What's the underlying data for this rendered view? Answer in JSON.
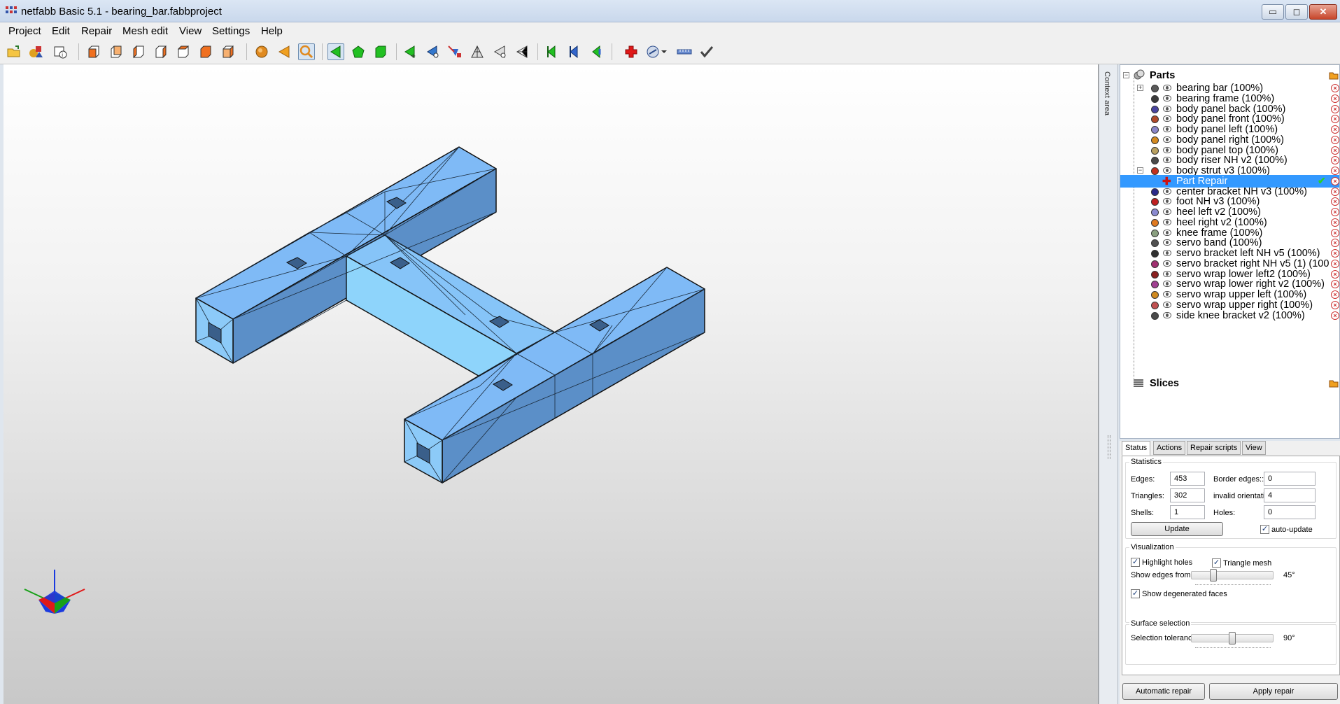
{
  "window": {
    "title": "netfabb Basic 5.1 - bearing_bar.fabbproject",
    "controls": {
      "minimize": "▭",
      "maximize": "◻",
      "close": "✕"
    }
  },
  "menu": [
    "Project",
    "Edit",
    "Repair",
    "Mesh edit",
    "View",
    "Settings",
    "Help"
  ],
  "toolbar": {
    "icons": [
      "open-project-icon",
      "add-part-icon",
      "part-info-icon",
      "view-front-icon",
      "view-back-icon",
      "view-left-icon",
      "view-right-icon",
      "view-top-icon",
      "view-bottom-icon",
      "view-iso-icon",
      "shading-icon",
      "select-triangle-icon",
      "zoom-icon",
      "select-pointer-icon",
      "select-surface-icon",
      "select-shell-icon",
      "add-triangle-icon",
      "cut-icon",
      "move-icon",
      "mesh-icon",
      "mesh-remove-icon",
      "mesh-edit-icon",
      "arrow-green-icon",
      "arrow-blue-icon",
      "arrow-back-icon",
      "add-repair-icon",
      "measure-icon",
      "ruler-icon",
      "apply-check-icon"
    ]
  },
  "context_area": {
    "label": "Context area"
  },
  "tree": {
    "root": "Parts",
    "parts": [
      {
        "label": "bearing bar (100%)",
        "color": "#5a5a5a"
      },
      {
        "label": "bearing frame (100%)",
        "color": "#3a3a3a"
      },
      {
        "label": "body panel back (100%)",
        "color": "#4a45a0"
      },
      {
        "label": "body panel front (100%)",
        "color": "#b04a2a"
      },
      {
        "label": "body panel left (100%)",
        "color": "#8a86c8"
      },
      {
        "label": "body panel right (100%)",
        "color": "#d48a20"
      },
      {
        "label": "body panel top (100%)",
        "color": "#b8a060"
      },
      {
        "label": "body riser NH v2 (100%)",
        "color": "#4a4a4a"
      },
      {
        "label": "body strut v3 (100%)",
        "color": "#c03020"
      },
      {
        "label": "Part Repair",
        "color": "#cc1111"
      },
      {
        "label": "center bracket NH v3 (100%)",
        "color": "#2a2a8a"
      },
      {
        "label": "foot NH v3 (100%)",
        "color": "#c02020"
      },
      {
        "label": "heel left v2 (100%)",
        "color": "#8a8ad0"
      },
      {
        "label": "heel right v2 (100%)",
        "color": "#e07a20"
      },
      {
        "label": "knee frame (100%)",
        "color": "#8aa080"
      },
      {
        "label": "servo band (100%)",
        "color": "#505050"
      },
      {
        "label": "servo bracket left NH v5 (100%)",
        "color": "#303030"
      },
      {
        "label": "servo bracket right NH v5 (1) (100",
        "color": "#a03070"
      },
      {
        "label": "servo wrap lower left2 (100%)",
        "color": "#8a2020"
      },
      {
        "label": "servo wrap lower right v2 (100%)",
        "color": "#a04090"
      },
      {
        "label": "servo wrap upper left (100%)",
        "color": "#d08a20"
      },
      {
        "label": "servo wrap upper right (100%)",
        "color": "#c05050"
      },
      {
        "label": "side knee bracket v2 (100%)",
        "color": "#4a4a4a"
      }
    ],
    "slices": "Slices"
  },
  "tabs": [
    "Status",
    "Actions",
    "Repair scripts",
    "View"
  ],
  "statistics": {
    "title": "Statistics",
    "edges_label": "Edges:",
    "edges": "453",
    "triangles_label": "Triangles:",
    "triangles": "302",
    "shells_label": "Shells:",
    "shells": "1",
    "border_edges_label": "Border edges::",
    "border_edges": "0",
    "invalid_orientation_label": "invalid orientation:",
    "invalid_orientation": "4",
    "holes_label": "Holes:",
    "holes": "0",
    "update_button": "Update",
    "auto_update": "auto-update"
  },
  "visualization": {
    "title": "Visualization",
    "highlight_holes": "Highlight holes",
    "triangle_mesh": "Triangle mesh",
    "show_edges_from": "Show edges from",
    "edges_angle": "45°",
    "edges_level": 0.25,
    "show_degenerated": "Show degenerated faces"
  },
  "surface_selection": {
    "title": "Surface selection",
    "tolerance_label": "Selection tolerance:",
    "tolerance_value": "90°",
    "tolerance_level": 0.5
  },
  "actions": {
    "automatic_repair": "Automatic repair",
    "apply_repair": "Apply repair"
  }
}
